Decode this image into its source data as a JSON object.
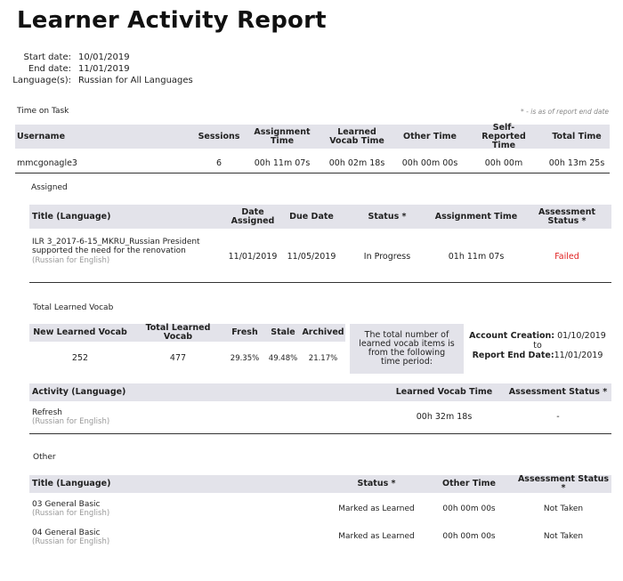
{
  "title": "Learner Activity Report",
  "meta": {
    "start_label": "Start date:",
    "start_value": "10/01/2019",
    "end_label": "End date:",
    "end_value": "11/01/2019",
    "lang_label": "Language(s):",
    "lang_value": "Russian for All Languages"
  },
  "time_on_task": {
    "label": "Time on Task",
    "note": "* - is as of report end date",
    "headers": [
      "Username",
      "Sessions",
      "Assignment Time",
      "Learned Vocab Time",
      "Other Time",
      "Self-Reported Time",
      "Total Time"
    ],
    "row": [
      "mmcgonagle3",
      "6",
      "00h 11m 07s",
      "00h 02m 18s",
      "00h 00m 00s",
      "00h 00m",
      "00h 13m 25s"
    ]
  },
  "assigned": {
    "label": "Assigned",
    "headers": [
      "Title (Language)",
      "Date Assigned",
      "Due Date",
      "Status *",
      "Assignment Time",
      "Assessment Status *"
    ],
    "row": {
      "title": "ILR 3_2017-6-15_MKRU_Russian President supported the need for the renovation",
      "language": "(Russian for English)",
      "date_assigned": "11/01/2019",
      "due_date": "11/05/2019",
      "status": "In Progress",
      "assignment_time": "01h 11m 07s",
      "assessment_status": "Failed"
    }
  },
  "vocab": {
    "label": "Total Learned Vocab",
    "headers": [
      "New Learned Vocab",
      "Total Learned Vocab",
      "Fresh",
      "Stale",
      "Archived"
    ],
    "row": [
      "252",
      "477",
      "29.35%",
      "49.48%",
      "21.17%"
    ],
    "note": "The total number of learned vocab items is from the following time period:",
    "account_creation_label": "Account Creation:",
    "account_creation_value": "01/10/2019",
    "to": "to",
    "report_end_label": "Report End Date:",
    "report_end_value": "11/01/2019",
    "activity_headers": [
      "Activity (Language)",
      "Learned Vocab Time",
      "Assessment Status *"
    ],
    "activity_row": {
      "title": "Refresh",
      "language": "(Russian for English)",
      "time": "00h 32m 18s",
      "assessment_status": "-"
    }
  },
  "other": {
    "label": "Other",
    "headers": [
      "Title (Language)",
      "Status *",
      "Other Time",
      "Assessment Status *"
    ],
    "rows": [
      {
        "title": "03 General Basic",
        "language": "(Russian for English)",
        "status": "Marked as Learned",
        "time": "00h 00m 00s",
        "assessment_status": "Not Taken"
      },
      {
        "title": "04 General Basic",
        "language": "(Russian for English)",
        "status": "Marked as Learned",
        "time": "00h 00m 00s",
        "assessment_status": "Not Taken"
      }
    ]
  },
  "colors": {
    "header_bg": "#e3e3ea",
    "failed": "#e02020"
  }
}
